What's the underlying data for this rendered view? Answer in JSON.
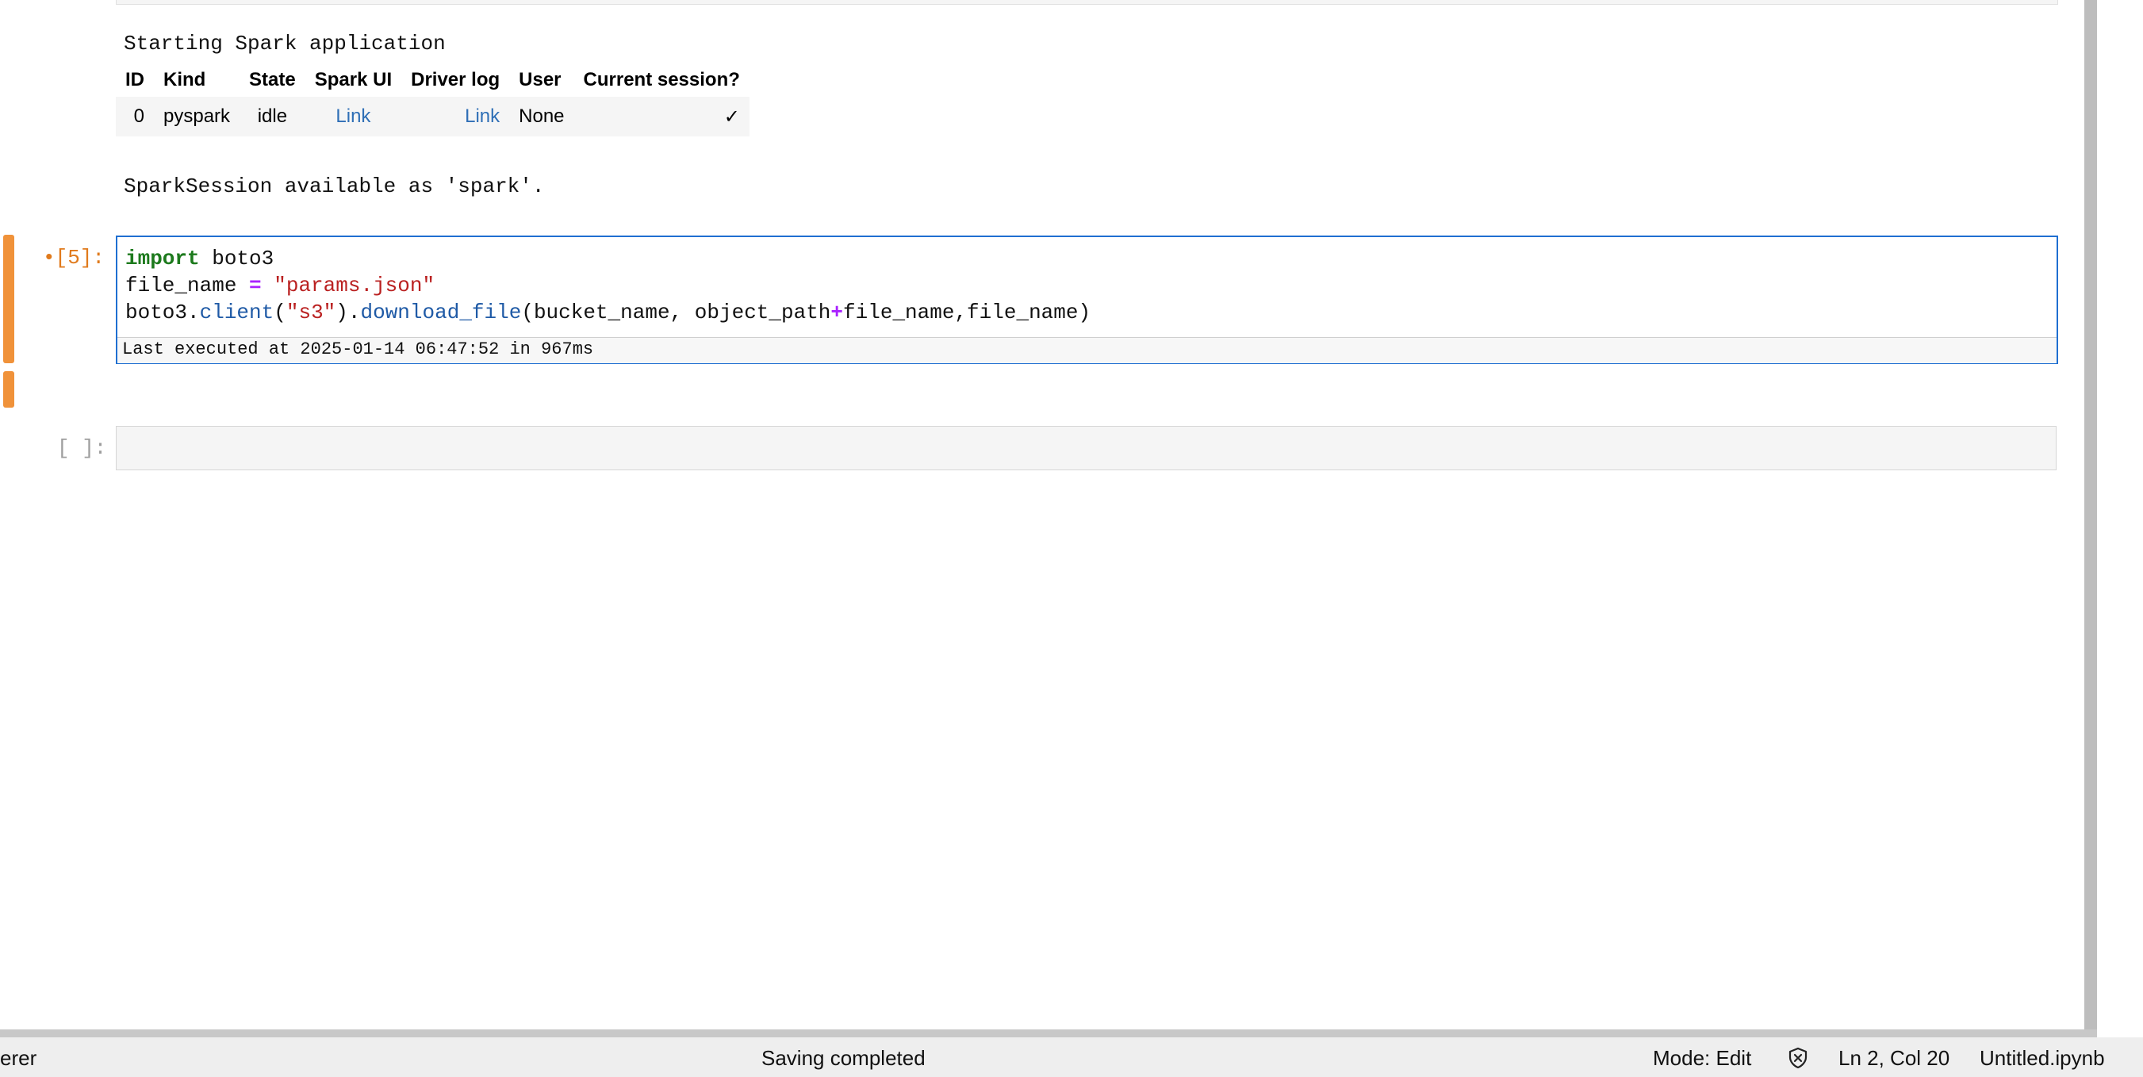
{
  "output": {
    "starting_text": "Starting Spark application",
    "table": {
      "headers": [
        "ID",
        "Kind",
        "State",
        "Spark UI",
        "Driver log",
        "User",
        "Current session?"
      ],
      "row": {
        "id": "0",
        "kind": "pyspark",
        "state": "idle",
        "spark_ui_link": "Link",
        "driver_log_link": "Link",
        "user": "None",
        "current_session": "✓"
      }
    },
    "session_text": "SparkSession available as 'spark'."
  },
  "code_cell": {
    "prompt": "•[5]:",
    "line1": {
      "kw": "import",
      "rest": " boto3"
    },
    "line2": {
      "a": "file_name ",
      "op": "=",
      "b": " ",
      "str": "\"params.json\""
    },
    "line3": {
      "a": "boto3.",
      "fn1": "client",
      "b": "(",
      "str": "\"s3\"",
      "c": ").",
      "fn2": "download_file",
      "d": "(bucket_name, object_path",
      "op": "+",
      "e": "file_name,file_name)"
    },
    "exec_info": "Last executed at 2025-01-14 06:47:52 in 967ms"
  },
  "empty_cell": {
    "prompt": "[ ]:"
  },
  "status_bar": {
    "left_text": "erer",
    "center_text": "Saving completed",
    "mode": "Mode: Edit",
    "shield_icon": "shield-x-icon",
    "position": "Ln 2, Col 20",
    "filename": "Untitled.ipynb"
  },
  "colors": {
    "accent": "#1f6fd1",
    "active_cell_bar": "#f0923a",
    "keyword": "#1d7a1d",
    "string": "#ba2121",
    "function": "#1f5aa6",
    "operator": "#aa22ff",
    "link": "#2f6fb6"
  }
}
